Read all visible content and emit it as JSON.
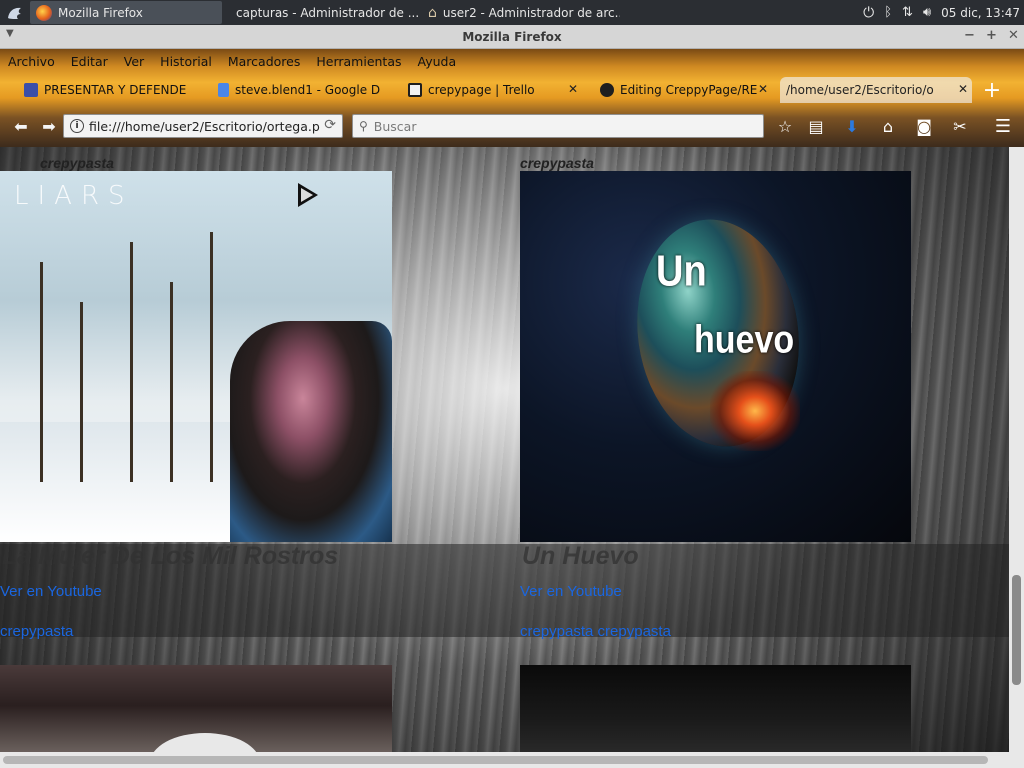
{
  "taskbar": {
    "tasks": [
      {
        "label": "Mozilla Firefox",
        "icon": "firefox-icon",
        "active": true
      },
      {
        "label": "capturas - Administrador de ...",
        "icon": "folder-icon",
        "active": false
      },
      {
        "label": "user2 - Administrador de arc...",
        "icon": "home-icon",
        "active": false
      }
    ],
    "clock": "05 dic, 13:47"
  },
  "window": {
    "title": "Mozilla Firefox",
    "buttons": {
      "minimize": "−",
      "maximize": "+",
      "close": "✕"
    }
  },
  "menubar": {
    "items": [
      "Archivo",
      "Editar",
      "Ver",
      "Historial",
      "Marcadores",
      "Herramientas",
      "Ayuda"
    ]
  },
  "tabs": [
    {
      "label": "PRESENTAR Y DEFENDE",
      "icon": "profile-icon",
      "color": "#3b4fa8"
    },
    {
      "label": "steve.blend1 - Google D",
      "icon": "doc-icon",
      "color": "#4a86e8"
    },
    {
      "label": "crepypage | Trello",
      "icon": "trello-icon",
      "color": "#1f1f1f"
    },
    {
      "label": "Editing CreppyPage/RE",
      "icon": "github-icon",
      "color": "#1f1f1f"
    },
    {
      "label": "/home/user2/Escritorio/o",
      "icon": "",
      "color": "#ffffff"
    }
  ],
  "navbar": {
    "url": "file:///home/user2/Escritorio/ortega.p",
    "search_placeholder": "Buscar"
  },
  "page": {
    "cards": [
      {
        "category": "crepypasta",
        "overlay_text": "LIARS",
        "title": "La Mujer De Los Mil Rostros",
        "link": "Ver en Youtube",
        "tags": "crepypasta"
      },
      {
        "category": "crepypasta",
        "overlay_line1": "Un",
        "overlay_line2": "huevo",
        "title": "Un Huevo",
        "link": "Ver en Youtube",
        "tags": "crepypasta crepypasta"
      }
    ]
  },
  "colors": {
    "link": "#1a66e0",
    "taskbar": "#2b2e33",
    "titlebar": "#d6d6d6"
  }
}
